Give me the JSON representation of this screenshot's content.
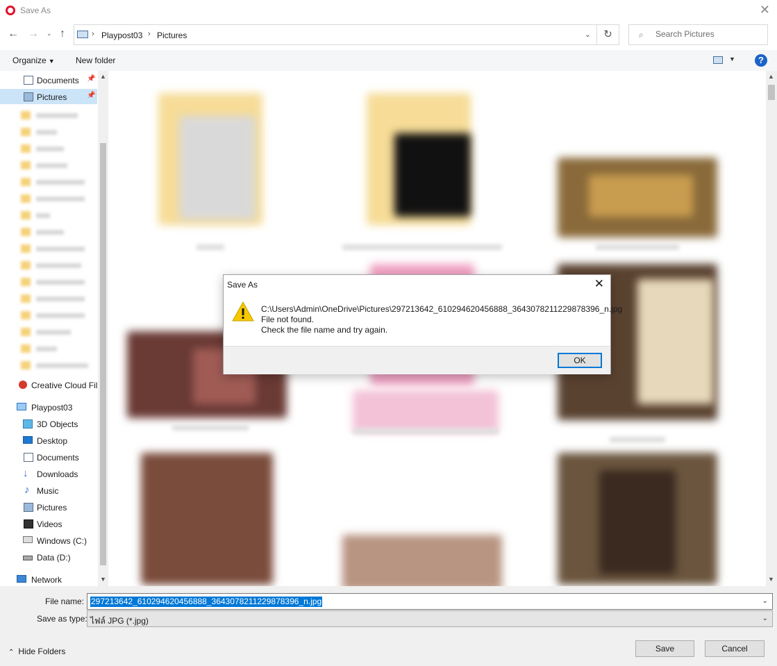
{
  "window": {
    "title": "Save As"
  },
  "address": {
    "crumbs": [
      "Playpost03",
      "Pictures"
    ],
    "search_placeholder": "Search Pictures"
  },
  "toolbar": {
    "organize": "Organize",
    "new_folder": "New folder"
  },
  "sidebar": {
    "quick_access": [
      {
        "label": "Documents",
        "pinned": true
      },
      {
        "label": "Pictures",
        "pinned": true,
        "selected": true
      }
    ],
    "items": [
      {
        "label": "Creative Cloud Fil",
        "icon": "creative-cloud-icon"
      },
      {
        "label": "Playpost03",
        "icon": "computer-icon"
      },
      {
        "label": "3D Objects",
        "icon": "cube-icon"
      },
      {
        "label": "Desktop",
        "icon": "desktop-icon"
      },
      {
        "label": "Documents",
        "icon": "document-icon"
      },
      {
        "label": "Downloads",
        "icon": "download-arrow-icon"
      },
      {
        "label": "Music",
        "icon": "music-note-icon"
      },
      {
        "label": "Pictures",
        "icon": "pictures-icon"
      },
      {
        "label": "Videos",
        "icon": "film-icon"
      },
      {
        "label": "Windows (C:)",
        "icon": "windows-drive-icon"
      },
      {
        "label": "Data (D:)",
        "icon": "drive-icon"
      },
      {
        "label": "Network",
        "icon": "network-icon"
      }
    ]
  },
  "bottom": {
    "file_name_label": "File name:",
    "file_name_value": "297213642_610294620456888_3643078211229878396_n.jpg",
    "save_type_label": "Save as type:",
    "save_type_value": "ไฟล์ JPG (*.jpg)",
    "hide_folders": "Hide Folders",
    "save_button": "Save",
    "cancel_button": "Cancel"
  },
  "dialog": {
    "title": "Save As",
    "path": "C:\\Users\\Admin\\OneDrive\\Pictures\\297213642_610294620456888_3643078211229878396_n.jpg",
    "line2": "File not found.",
    "line3": "Check the file name and try again.",
    "ok": "OK"
  },
  "colors": {
    "accent": "#0078d7",
    "selected_nav": "#cce4f7",
    "warning": "#f5c800"
  }
}
